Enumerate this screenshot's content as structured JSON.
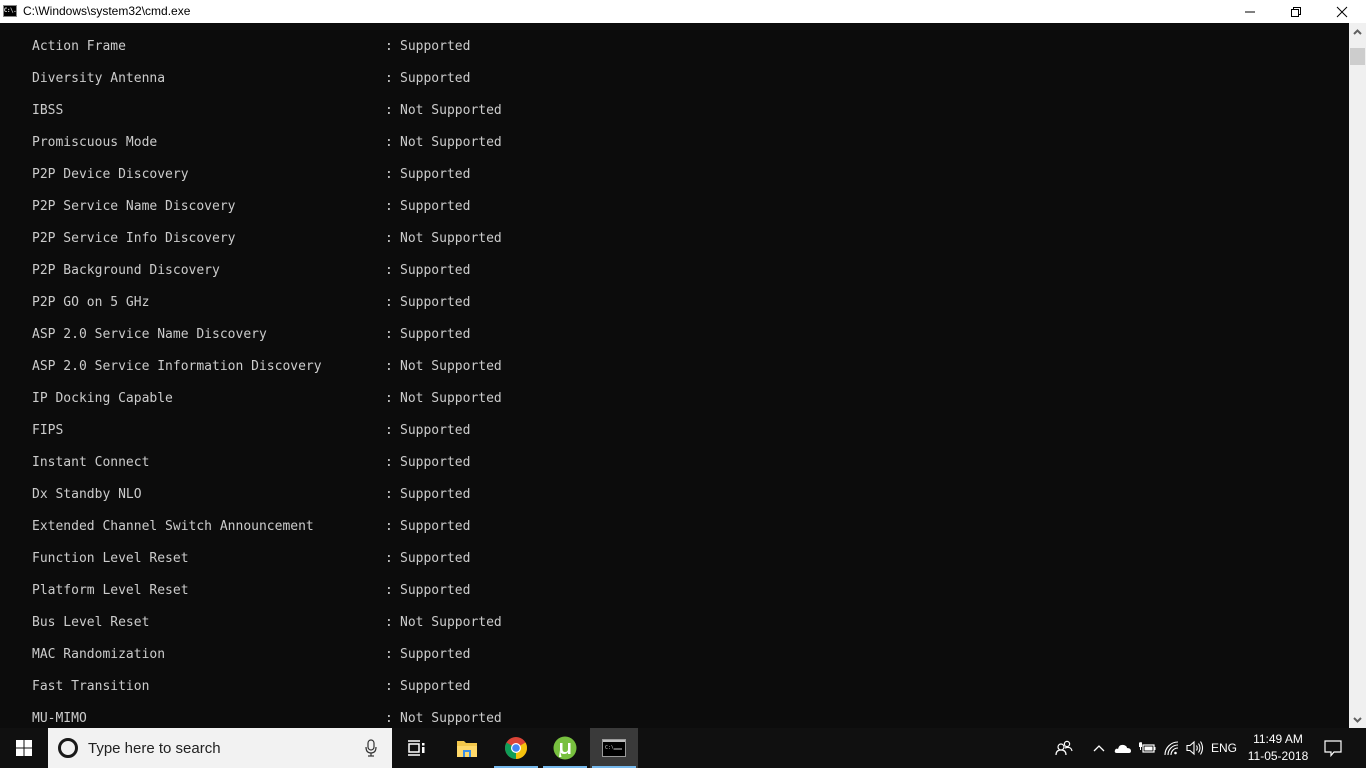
{
  "window": {
    "title": "C:\\Windows\\system32\\cmd.exe",
    "icon": "cmd-icon",
    "icon_text": "C:\\.",
    "controls": [
      "minimize",
      "restore",
      "close"
    ]
  },
  "console": {
    "text_color": "#cccccc",
    "background": "#0c0c0c",
    "separator": ":",
    "lines": [
      {
        "key": "Action Frame",
        "value": "Supported"
      },
      {
        "key": "Diversity Antenna",
        "value": "Supported"
      },
      {
        "key": "IBSS",
        "value": "Not Supported"
      },
      {
        "key": "Promiscuous Mode",
        "value": "Not Supported"
      },
      {
        "key": "P2P Device Discovery",
        "value": "Supported"
      },
      {
        "key": "P2P Service Name Discovery",
        "value": "Supported"
      },
      {
        "key": "P2P Service Info Discovery",
        "value": "Not Supported"
      },
      {
        "key": "P2P Background Discovery",
        "value": "Supported"
      },
      {
        "key": "P2P GO on 5 GHz",
        "value": "Supported"
      },
      {
        "key": "ASP 2.0 Service Name Discovery",
        "value": "Supported"
      },
      {
        "key": "ASP 2.0 Service Information Discovery",
        "value": "Not Supported"
      },
      {
        "key": "IP Docking Capable",
        "value": "Not Supported"
      },
      {
        "key": "FIPS",
        "value": "Supported"
      },
      {
        "key": "Instant Connect",
        "value": "Supported"
      },
      {
        "key": "Dx Standby NLO",
        "value": "Supported"
      },
      {
        "key": "Extended Channel Switch Announcement",
        "value": "Supported"
      },
      {
        "key": "Function Level Reset",
        "value": "Supported"
      },
      {
        "key": "Platform Level Reset",
        "value": "Supported"
      },
      {
        "key": "Bus Level Reset",
        "value": "Not Supported"
      },
      {
        "key": "MAC Randomization",
        "value": "Supported"
      },
      {
        "key": "Fast Transition",
        "value": "Supported"
      },
      {
        "key": "MU-MIMO",
        "value": "Not Supported"
      }
    ]
  },
  "taskbar": {
    "search_placeholder": "Type here to search",
    "apps": [
      {
        "name": "Task View",
        "icon": "task-view-icon"
      },
      {
        "name": "File Explorer",
        "icon": "file-explorer-icon"
      },
      {
        "name": "Google Chrome",
        "icon": "chrome-icon",
        "running": true
      },
      {
        "name": "uTorrent",
        "icon": "utorrent-icon",
        "running": true
      },
      {
        "name": "Command Prompt",
        "icon": "cmd-icon",
        "running": true,
        "active": true
      }
    ],
    "tray": {
      "people": "people-icon",
      "show_hidden": "chevron-up-icon",
      "onedrive": "onedrive-icon",
      "battery": "battery-charging-icon",
      "network": "wifi-icon",
      "volume": "volume-icon",
      "language": "ENG",
      "time": "11:49 AM",
      "date": "11-05-2018",
      "notifications": "action-center-icon"
    },
    "accent": "#76b9ed"
  }
}
